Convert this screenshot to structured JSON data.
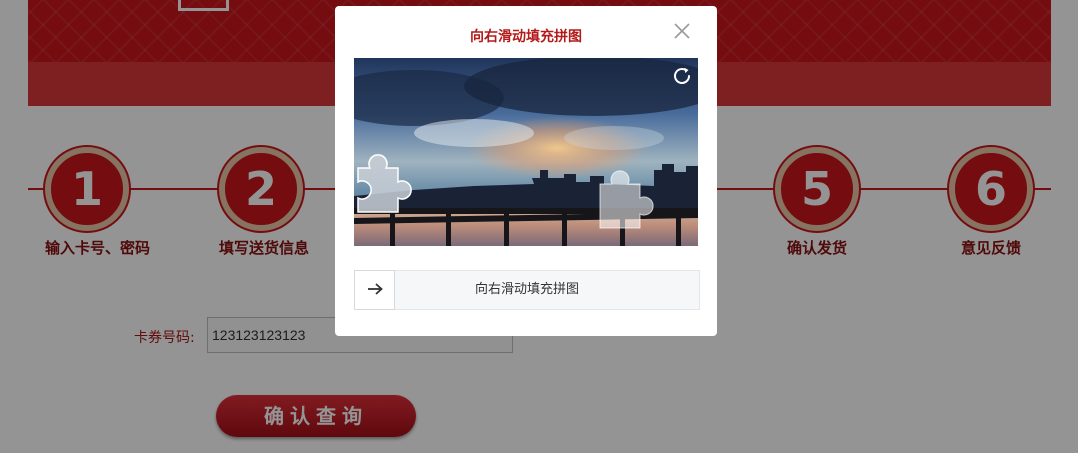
{
  "steps": [
    {
      "number": "1",
      "label": "输入卡号、密码"
    },
    {
      "number": "2",
      "label": "填写送货信息"
    },
    {
      "number": "5",
      "label": "确认发货"
    },
    {
      "number": "6",
      "label": "意见反馈"
    }
  ],
  "form": {
    "card_label": "卡券号码:",
    "card_value": "123123123123",
    "submit_label": "确认查询"
  },
  "captcha": {
    "title": "向右滑动填充拼图",
    "slider_hint": "向右滑动填充拼图",
    "slider_progress": 0,
    "icons": {
      "close": "close-icon",
      "refresh": "refresh-icon",
      "handle": "arrow-right-icon"
    }
  },
  "colors": {
    "brand_red": "#c8161d",
    "title_red": "#b31b1b"
  }
}
